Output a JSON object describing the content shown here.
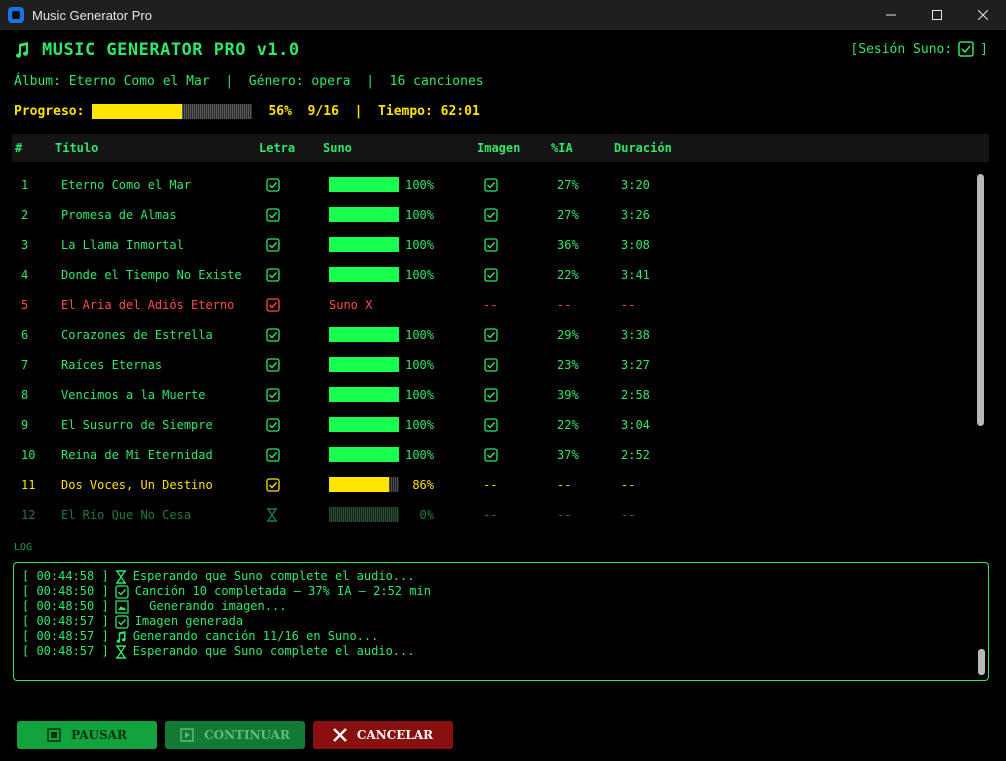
{
  "window": {
    "title": "Music Generator Pro"
  },
  "header": {
    "title": "MUSIC GENERATOR PRO v1.0",
    "session": "[Sesión Suno:",
    "session_icon": "checkbox-icon"
  },
  "album_line": "Álbum: Eterno Como el Mar  |  Género: opera  |  16 canciones",
  "progress": {
    "label": "Progreso:",
    "value": 0.56,
    "percent": "56%",
    "count": "9/16",
    "separator": "|",
    "time_label": "Tiempo:",
    "time": "62:01"
  },
  "table": {
    "headers": [
      "#",
      "Título",
      "Letra",
      "Suno",
      "Imagen",
      "%IA",
      "Duración"
    ],
    "rows": [
      {
        "num": "1",
        "title": "Eterno Como el Mar",
        "letra": "check",
        "suno": 1.0,
        "suno_text": "100%",
        "imagen": "check",
        "ia": "27%",
        "dur": "3:20",
        "state": "done"
      },
      {
        "num": "2",
        "title": "Promesa de Almas",
        "letra": "check",
        "suno": 1.0,
        "suno_text": "100%",
        "imagen": "check",
        "ia": "27%",
        "dur": "3:26",
        "state": "done"
      },
      {
        "num": "3",
        "title": "La Llama Inmortal",
        "letra": "check",
        "suno": 1.0,
        "suno_text": "100%",
        "imagen": "check",
        "ia": "36%",
        "dur": "3:08",
        "state": "done"
      },
      {
        "num": "4",
        "title": "Donde el Tiempo No Existe",
        "letra": "check",
        "suno": 1.0,
        "suno_text": "100%",
        "imagen": "check",
        "ia": "22%",
        "dur": "3:41",
        "state": "done"
      },
      {
        "num": "5",
        "title": "El Aria del Adiós Eterno",
        "letra": "check",
        "suno": null,
        "suno_text": "Suno X",
        "imagen": "--",
        "ia": "--",
        "dur": "--",
        "state": "err"
      },
      {
        "num": "6",
        "title": "Corazones de Estrella",
        "letra": "check",
        "suno": 1.0,
        "suno_text": "100%",
        "imagen": "check",
        "ia": "29%",
        "dur": "3:38",
        "state": "done"
      },
      {
        "num": "7",
        "title": "Raíces Eternas",
        "letra": "check",
        "suno": 1.0,
        "suno_text": "100%",
        "imagen": "check",
        "ia": "23%",
        "dur": "3:27",
        "state": "done"
      },
      {
        "num": "8",
        "title": "Vencimos a la Muerte",
        "letra": "check",
        "suno": 1.0,
        "suno_text": "100%",
        "imagen": "check",
        "ia": "39%",
        "dur": "2:58",
        "state": "done"
      },
      {
        "num": "9",
        "title": "El Susurro de Siempre",
        "letra": "check",
        "suno": 1.0,
        "suno_text": "100%",
        "imagen": "check",
        "ia": "22%",
        "dur": "3:04",
        "state": "done"
      },
      {
        "num": "10",
        "title": "Reina de Mi Eternidad",
        "letra": "check",
        "suno": 1.0,
        "suno_text": "100%",
        "imagen": "check",
        "ia": "37%",
        "dur": "2:52",
        "state": "done"
      },
      {
        "num": "11",
        "title": "Dos Voces, Un Destino",
        "letra": "check",
        "suno": 0.86,
        "suno_text": "86%",
        "imagen": "--",
        "ia": "--",
        "dur": "--",
        "state": "cur"
      },
      {
        "num": "12",
        "title": "El Río Que No Cesa",
        "letra": "hourglass",
        "suno": 0.0,
        "suno_text": "0%",
        "imagen": "--",
        "ia": "--",
        "dur": "--",
        "state": "pend"
      }
    ]
  },
  "log": {
    "label": "LOG",
    "lines": [
      {
        "time": "[ 00:44:58 ]",
        "icon": "hourglass-icon",
        "text": "Esperando que Suno complete el audio..."
      },
      {
        "time": "[ 00:48:50 ]",
        "icon": "checkbox-icon",
        "text": "Canción 10 completada — 37% IA — 2:52 min"
      },
      {
        "time": "[ 00:48:50 ]",
        "icon": "image-icon",
        "text": "  Generando imagen..."
      },
      {
        "time": "[ 00:48:57 ]",
        "icon": "checkbox-icon",
        "text": "Imagen generada"
      },
      {
        "time": "[ 00:48:57 ]",
        "icon": "music-note-icon",
        "text": "Generando canción 11/16 en Suno..."
      },
      {
        "time": "[ 00:48:57 ]",
        "icon": "hourglass-icon",
        "text": "Esperando que Suno complete el audio..."
      }
    ]
  },
  "buttons": {
    "pause": "PAUSAR",
    "continue": "CONTINUAR",
    "cancel": "CANCELAR"
  },
  "colors": {
    "green": "#2ee86a",
    "yellow": "#ffe100",
    "red": "#ff4a4a",
    "bar_green": "#18ff4f"
  }
}
